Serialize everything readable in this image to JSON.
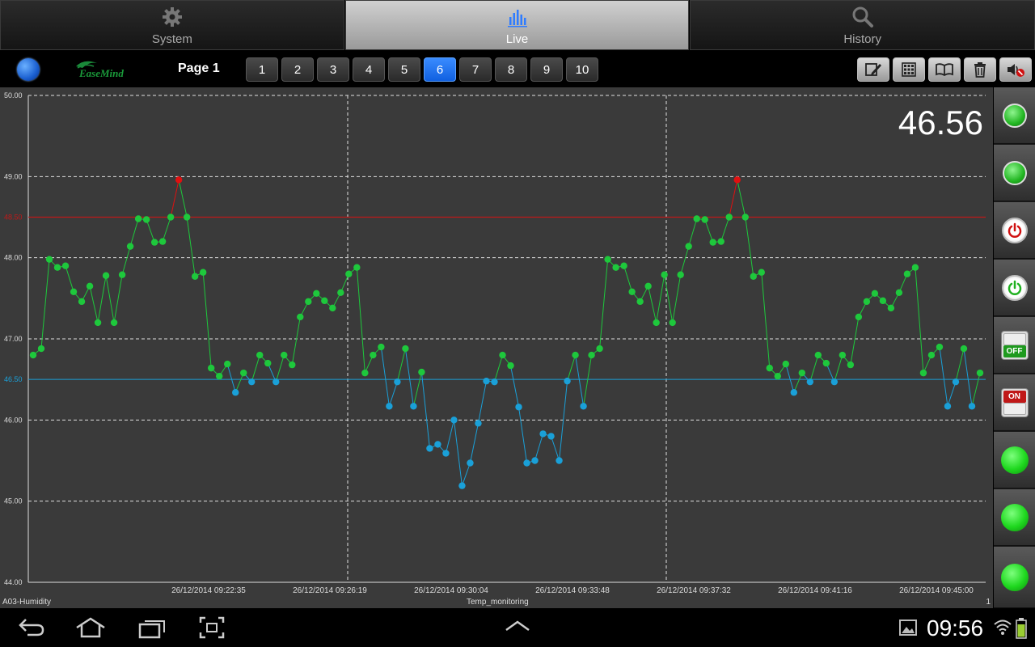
{
  "tabs": [
    {
      "label": "System",
      "icon": "gear-icon",
      "active": false
    },
    {
      "label": "Live",
      "icon": "chart-bars-icon",
      "active": true
    },
    {
      "label": "History",
      "icon": "search-icon",
      "active": false
    }
  ],
  "toolbar": {
    "logo_text": "EaseMind",
    "page_label": "Page 1",
    "pages": [
      "1",
      "2",
      "3",
      "4",
      "5",
      "6",
      "7",
      "8",
      "9",
      "10"
    ],
    "selected_page": "6",
    "tools": [
      "edit-icon",
      "grid-icon",
      "book-icon",
      "trash-icon",
      "speaker-mute-icon"
    ]
  },
  "chart": {
    "current_value": "46.56",
    "series_name": "A03-Humidity",
    "chart_name": "Temp_monitoring",
    "page_index": "1",
    "high_limit_label": "48.50",
    "low_limit_label": "46.50",
    "y_tick_labels": [
      "50.00",
      "49.00",
      "48.00",
      "47.00",
      "46.00",
      "45.00",
      "44.00"
    ],
    "x_tick_labels": [
      "26/12/2014 09:22:35",
      "26/12/2014 09:26:19",
      "26/12/2014 09:30:04",
      "26/12/2014 09:33:48",
      "26/12/2014 09:37:32",
      "26/12/2014 09:41:16",
      "26/12/2014 09:45:00"
    ]
  },
  "chart_data": {
    "type": "line",
    "title": "Temp_monitoring",
    "series": [
      {
        "name": "A03-Humidity",
        "values": [
          46.8,
          46.88,
          47.98,
          47.88,
          47.9,
          47.58,
          47.46,
          47.65,
          47.2,
          47.78,
          47.2,
          47.79,
          48.14,
          48.48,
          48.47,
          48.19,
          48.2,
          48.5,
          48.96,
          48.5,
          47.77,
          47.82,
          46.64,
          46.54,
          46.69,
          46.34,
          46.58,
          46.47,
          46.8,
          46.7,
          46.47,
          46.8,
          46.68,
          47.27,
          47.46,
          47.56,
          47.47,
          47.38,
          47.57,
          47.8,
          47.88,
          46.58,
          46.8,
          46.9,
          46.17,
          46.47,
          46.88,
          46.17,
          46.59,
          45.65,
          45.7,
          45.59,
          46.0,
          45.19,
          45.47,
          45.96,
          46.48,
          46.47,
          46.8,
          46.67,
          46.16,
          45.47,
          45.5,
          45.83,
          45.8,
          45.5,
          46.48,
          46.8,
          46.17,
          46.8,
          46.88,
          47.98,
          47.88,
          47.9,
          47.58,
          47.46,
          47.65,
          47.2,
          47.79,
          47.2,
          47.79,
          48.14,
          48.48,
          48.47,
          48.19,
          48.2,
          48.5,
          48.96,
          48.5,
          47.77,
          47.82,
          46.64,
          46.54,
          46.69,
          46.34,
          46.58,
          46.47,
          46.8,
          46.7,
          46.47,
          46.8,
          46.68,
          47.27,
          47.46,
          47.56,
          47.47,
          47.38,
          47.57,
          47.8,
          47.88,
          46.58,
          46.8,
          46.9,
          46.17,
          46.47,
          46.88,
          46.17,
          46.58
        ]
      }
    ],
    "x_tick_labels": [
      "26/12/2014 09:22:35",
      "26/12/2014 09:26:19",
      "26/12/2014 09:30:04",
      "26/12/2014 09:33:48",
      "26/12/2014 09:37:32",
      "26/12/2014 09:41:16",
      "26/12/2014 09:45:00"
    ],
    "ylim": [
      44.0,
      50.0
    ],
    "y_ticks": [
      44.0,
      45.0,
      46.0,
      47.0,
      48.0,
      49.0,
      50.0
    ],
    "high_limit": 48.5,
    "low_limit": 46.5,
    "colors": {
      "normal": "#1ec83c",
      "low": "#1aa0d8",
      "high": "#e01010",
      "high_line": "#c01818",
      "low_line": "#1aa0d8"
    },
    "grid": true
  },
  "controls": [
    {
      "type": "led-small",
      "icon": "green-indicator-icon"
    },
    {
      "type": "led-small",
      "icon": "green-indicator-icon"
    },
    {
      "type": "power",
      "icon": "power-red-icon",
      "color": "#d01010"
    },
    {
      "type": "power",
      "icon": "power-green-icon",
      "color": "#20b020"
    },
    {
      "type": "switch-off",
      "label": "OFF",
      "icon": "off-switch-icon"
    },
    {
      "type": "switch-on",
      "label": "ON",
      "icon": "on-switch-icon"
    },
    {
      "type": "led-big",
      "icon": "green-light-icon"
    },
    {
      "type": "led-big",
      "icon": "green-light-icon"
    },
    {
      "type": "led-big",
      "icon": "green-light-icon"
    }
  ],
  "navbar": {
    "clock": "09:56",
    "icons": [
      "back-icon",
      "home-icon",
      "recent-apps-icon",
      "screenshot-icon",
      "up-chevron-icon",
      "gallery-icon",
      "wifi-icon",
      "battery-icon"
    ]
  }
}
